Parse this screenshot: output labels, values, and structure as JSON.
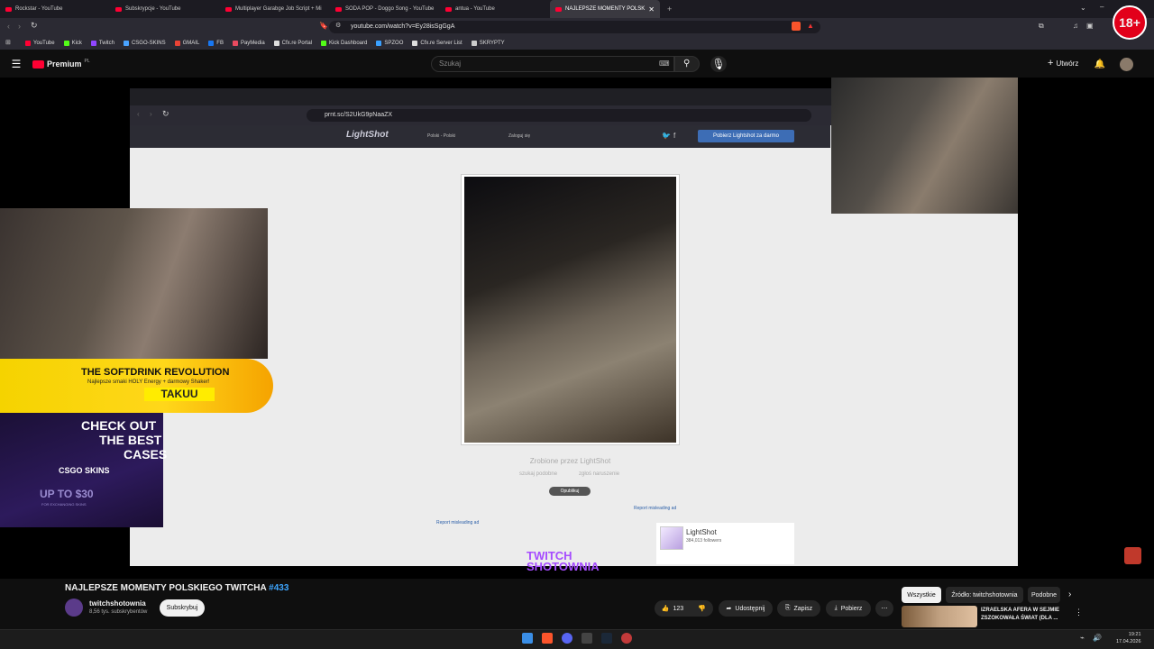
{
  "browser": {
    "tabs": [
      {
        "title": "Rockstar - YouTube"
      },
      {
        "title": "Subskrypcje - YouTube"
      },
      {
        "title": "Multiplayer Garabge Job Script + Mi"
      },
      {
        "title": "SODA POP - Doggo Song - YouTube"
      },
      {
        "title": "antua - YouTube"
      },
      {
        "title": "NAJLEPSZE MOMENTY POLSK"
      }
    ],
    "url": "youtube.com/watch?v=Ey28isSgGgA",
    "bookmarks": [
      {
        "label": "YouTube",
        "color": "#ff0033"
      },
      {
        "label": "Kick",
        "color": "#53fc18"
      },
      {
        "label": "Twitch",
        "color": "#9146ff"
      },
      {
        "label": "CSGO-SKINS",
        "color": "#4aa3ff"
      },
      {
        "label": "GMAIL",
        "color": "#ea4335"
      },
      {
        "label": "FB",
        "color": "#1877f2"
      },
      {
        "label": "PayMedia",
        "color": "#e84a5f"
      },
      {
        "label": "Cfx.re Portal",
        "color": "#dddddd"
      },
      {
        "label": "Kick Dashboard",
        "color": "#53fc18"
      },
      {
        "label": "SPZOO",
        "color": "#3aa0ff"
      },
      {
        "label": "Cfx.re Server List",
        "color": "#dddddd"
      },
      {
        "label": "SKRYPTY",
        "color": "#cccccc"
      }
    ]
  },
  "youtube": {
    "logo_text": "Premium",
    "logo_badge": "PL",
    "search_placeholder": "Szukaj",
    "create_label": "Utwórz"
  },
  "inner_browser": {
    "url": "prnt.sc/S2UkG9pNaaZX",
    "lightshot_logo": "LightShot",
    "language": "Polski - Polski",
    "login": "Zaloguj się",
    "download_button": "Pobierz Lightshot za darmo",
    "caption": "Zrobione przez LightShot",
    "link_similar": "szukaj podobne",
    "link_report": "zgłoś naruszenie",
    "post_button": "Opublikuj",
    "report_ad_1": "Report misleading ad",
    "report_ad_2": "Report misleading ad",
    "ls_card_name": "LightShot",
    "ls_card_followers": "384,013 followers"
  },
  "overlays": {
    "promo_title": "THE SOFTDRINK REVOLUTION",
    "promo_sub": "Najlepsze smaki HOLY Energy + darmowy Shaker!",
    "promo_code": "TAKUU",
    "csgo_line1": "CHECK OUT",
    "csgo_line2": "THE BEST",
    "csgo_line3": "CASES",
    "csgo_brand": "CSGO SKINS",
    "csgo_offer": "UP TO $30",
    "csgo_offer_sub": "FOR EXCHANGING SKINS",
    "watermark_1": "TWITCH",
    "watermark_2": "SHOTOWNIA",
    "age_badge": "18+"
  },
  "video": {
    "title": "NAJLEPSZE MOMENTY POLSKIEGO TWITCHA",
    "hashtag": "#433",
    "channel": "twitchshotownia",
    "subscribers": "8,56 tys. subskrybentów",
    "subscribe_label": "Subskrybuj",
    "likes": "123",
    "share_label": "Udostępnij",
    "save_label": "Zapisz",
    "download_label": "Pobierz"
  },
  "filters": [
    "Wszystkie",
    "Źródło: twitchshotownia",
    "Podobne"
  ],
  "recommended": {
    "title_line1": "IZRAELSKA AFERA W SEJMIE",
    "title_line2": "ZSZOKOWAŁA ŚWIAT (DLA ..."
  },
  "taskbar": {
    "time": "19:21",
    "date": "17.04.2026"
  },
  "colors": {
    "accent_red": "#ff0033",
    "hashtag_blue": "#3ea6ff",
    "lightshot_btn": "#3d6db5"
  }
}
